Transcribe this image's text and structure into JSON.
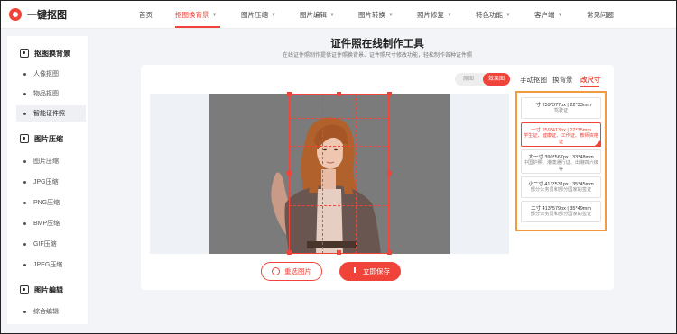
{
  "app": {
    "title": "一键抠图"
  },
  "nav": [
    {
      "label": "首页",
      "caret": false
    },
    {
      "label": "抠图换背景",
      "caret": true,
      "active": true
    },
    {
      "label": "图片压缩",
      "caret": true
    },
    {
      "label": "图片编辑",
      "caret": true
    },
    {
      "label": "图片转换",
      "caret": true
    },
    {
      "label": "照片修复",
      "caret": true
    },
    {
      "label": "特色功能",
      "caret": true
    },
    {
      "label": "客户端",
      "caret": true
    },
    {
      "label": "常见问题",
      "caret": false
    }
  ],
  "sidebar": {
    "groups": [
      {
        "label": "抠图换背景",
        "icon": "cutout-icon",
        "items": [
          "人像抠图",
          "物品抠图",
          "智能证件照"
        ]
      },
      {
        "label": "图片压缩",
        "icon": "compress-icon",
        "items": [
          "图片压缩",
          "JPG压缩",
          "PNG压缩",
          "BMP压缩",
          "GIF压缩",
          "JPEG压缩"
        ]
      },
      {
        "label": "图片编辑",
        "icon": "edit-icon",
        "items": [
          "综合编辑"
        ]
      }
    ],
    "active_item": "智能证件照"
  },
  "main": {
    "title": "证件照在线制作工具",
    "subtitle": "在线证件照制作提供证件照换背景、证件照尺寸修改功能，轻松制作各种证件照"
  },
  "toolbar": {
    "toggle": {
      "off_label": "原图",
      "on_label": "效果图"
    },
    "tabs": [
      "手动抠图",
      "换背景",
      "改尺寸"
    ],
    "active_tab": "改尺寸"
  },
  "editor": {
    "background_color": "#7b7b7b",
    "accent_color": "#f0443a"
  },
  "actions": {
    "reselect": "重选图片",
    "save": "立即保存"
  },
  "sizes": [
    {
      "l1": "一寸 259*377px | 22*33mm",
      "l2": "驾驶证"
    },
    {
      "l1": "一寸 259*413px | 22*35mm",
      "l2": "学生证、健康证、工作证、教师资格证",
      "selected": true
    },
    {
      "l1": "大一寸 390*567px | 33*48mm",
      "l2": "中国护照、港澳通行证、出港四六级等"
    },
    {
      "l1": "小二寸 413*531px | 35*45mm",
      "l2": "部分公务员和部分国家的签证"
    },
    {
      "l1": "二寸 413*579px | 35*49mm",
      "l2": "部分公务员和部分国家的签证"
    }
  ]
}
